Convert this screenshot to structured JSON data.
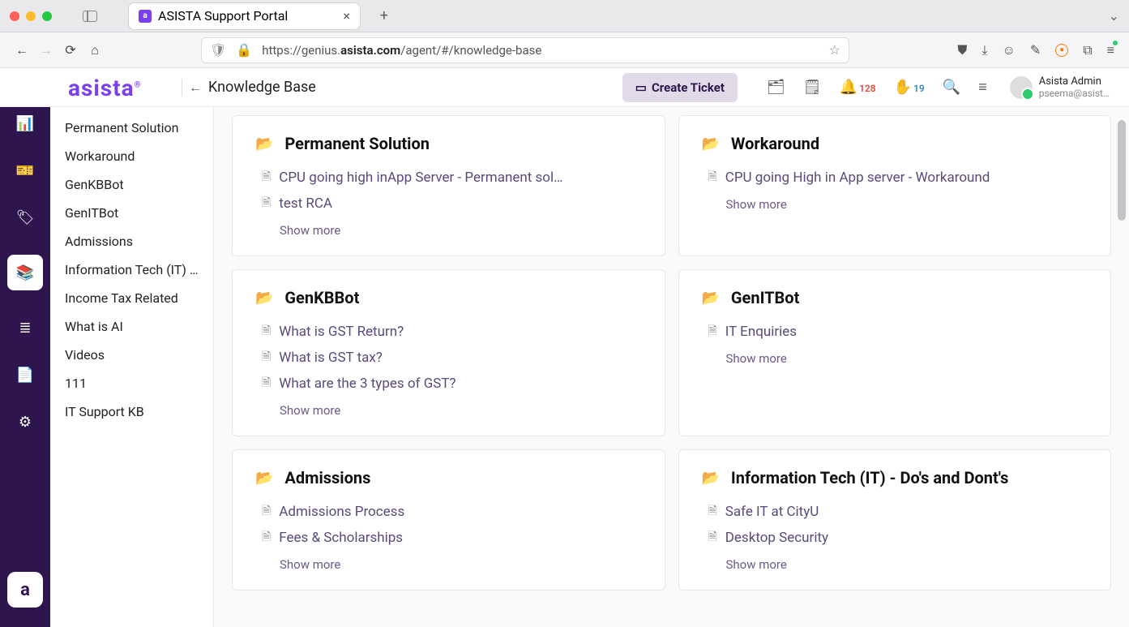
{
  "browser": {
    "tab_title": "ASISTA Support Portal",
    "url_prefix": "https://genius.",
    "url_bold": "asista.com",
    "url_suffix": "/agent/#/knowledge-base"
  },
  "app": {
    "logo": "asista",
    "page_title": "Knowledge Base",
    "create_btn": "Create Ticket",
    "notif_count": "128",
    "hand_count": "19",
    "user_name": "Asista Admin",
    "user_email": "pseema@asist…"
  },
  "sidebar": {
    "items": [
      "Permanent Solution",
      "Workaround",
      "GenKBBot",
      "GenITBot",
      "Admissions",
      "Information Tech (IT) …",
      "Income Tax Related",
      "What is AI",
      "Videos",
      "111",
      "IT Support KB"
    ]
  },
  "cards": [
    {
      "title": "Permanent Solution",
      "docs": [
        "CPU going high inApp Server - Permanent sol…",
        "test RCA"
      ],
      "show_more": "Show more"
    },
    {
      "title": "Workaround",
      "docs": [
        "CPU going High in App server - Workaround"
      ],
      "show_more": "Show more"
    },
    {
      "title": "GenKBBot",
      "docs": [
        "What is GST Return?",
        "What is GST tax?",
        "What are the 3 types of GST?"
      ],
      "show_more": "Show more"
    },
    {
      "title": "GenITBot",
      "docs": [
        "IT Enquiries"
      ],
      "show_more": "Show more"
    },
    {
      "title": "Admissions",
      "docs": [
        "Admissions Process",
        "Fees & Scholarships"
      ],
      "show_more": "Show more"
    },
    {
      "title": "Information Tech (IT) - Do's and Dont's",
      "docs": [
        "Safe IT at CityU",
        "Desktop Security"
      ],
      "show_more": "Show more"
    }
  ]
}
